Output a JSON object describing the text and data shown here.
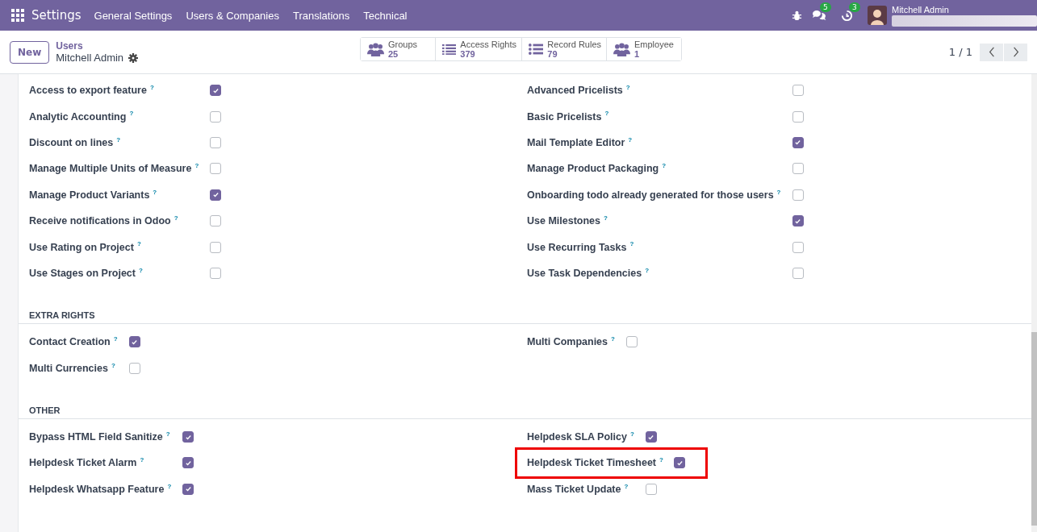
{
  "navbar": {
    "app_name": "Settings",
    "menus": [
      "General Settings",
      "Users & Companies",
      "Translations",
      "Technical"
    ],
    "messages_badge": "5",
    "activities_badge": "3",
    "user_name": "Mitchell Admin"
  },
  "control_panel": {
    "new_button": "New",
    "breadcrumb": "Users",
    "record_title": "Mitchell Admin",
    "stat_buttons": [
      {
        "label": "Groups",
        "value": "25",
        "kind": "users"
      },
      {
        "label": "Access Rights",
        "value": "379",
        "kind": "list"
      },
      {
        "label": "Record Rules",
        "value": "79",
        "kind": "bullets"
      },
      {
        "label": "Employee",
        "value": "1",
        "kind": "users"
      }
    ],
    "pager": "1 / 1"
  },
  "sections": [
    {
      "columns": [
        [
          {
            "label": "Access to export feature",
            "help": "?",
            "checked": true
          },
          {
            "label": "Analytic Accounting",
            "help": "?",
            "checked": false
          },
          {
            "label": "Discount on lines",
            "help": "?",
            "checked": false
          },
          {
            "label": "Manage Multiple Units of Measure",
            "help": "?",
            "checked": false
          },
          {
            "label": "Manage Product Variants",
            "help": "?",
            "checked": true
          },
          {
            "label": "Receive notifications in Odoo",
            "help": "?",
            "checked": false
          },
          {
            "label": "Use Rating on Project",
            "help": "?",
            "checked": false
          },
          {
            "label": "Use Stages on Project",
            "help": "?",
            "checked": false
          }
        ],
        [
          {
            "label": "Advanced Pricelists",
            "help": "?",
            "checked": false
          },
          {
            "label": "Basic Pricelists",
            "help": "?",
            "checked": false
          },
          {
            "label": "Mail Template Editor",
            "help": "?",
            "checked": true
          },
          {
            "label": "Manage Product Packaging",
            "help": "?",
            "checked": false
          },
          {
            "label": "Onboarding todo already generated for those users",
            "help": "?",
            "checked": false
          },
          {
            "label": "Use Milestones",
            "help": "?",
            "checked": true
          },
          {
            "label": "Use Recurring Tasks",
            "help": "?",
            "checked": false
          },
          {
            "label": "Use Task Dependencies",
            "help": "?",
            "checked": false
          }
        ]
      ]
    },
    {
      "title": "EXTRA RIGHTS",
      "columns": [
        [
          {
            "label": "Contact Creation",
            "help": "?",
            "checked": true
          },
          {
            "label": "Multi Currencies",
            "help": "?",
            "checked": false
          }
        ],
        [
          {
            "label": "Multi Companies",
            "help": "?",
            "checked": false
          }
        ]
      ]
    },
    {
      "title": "OTHER",
      "columns": [
        [
          {
            "label": "Bypass HTML Field Sanitize",
            "help": "?",
            "checked": true
          },
          {
            "label": "Helpdesk Ticket Alarm",
            "help": "?",
            "checked": true
          },
          {
            "label": "Helpdesk Whatsapp Feature",
            "help": "?",
            "checked": true
          }
        ],
        [
          {
            "label": "Helpdesk SLA Policy",
            "help": "?",
            "checked": true
          },
          {
            "label": "Helpdesk Ticket Timesheet",
            "help": "?",
            "checked": true,
            "highlighted": true
          },
          {
            "label": "Mass Ticket Update",
            "help": "?",
            "checked": false
          }
        ]
      ]
    }
  ]
}
